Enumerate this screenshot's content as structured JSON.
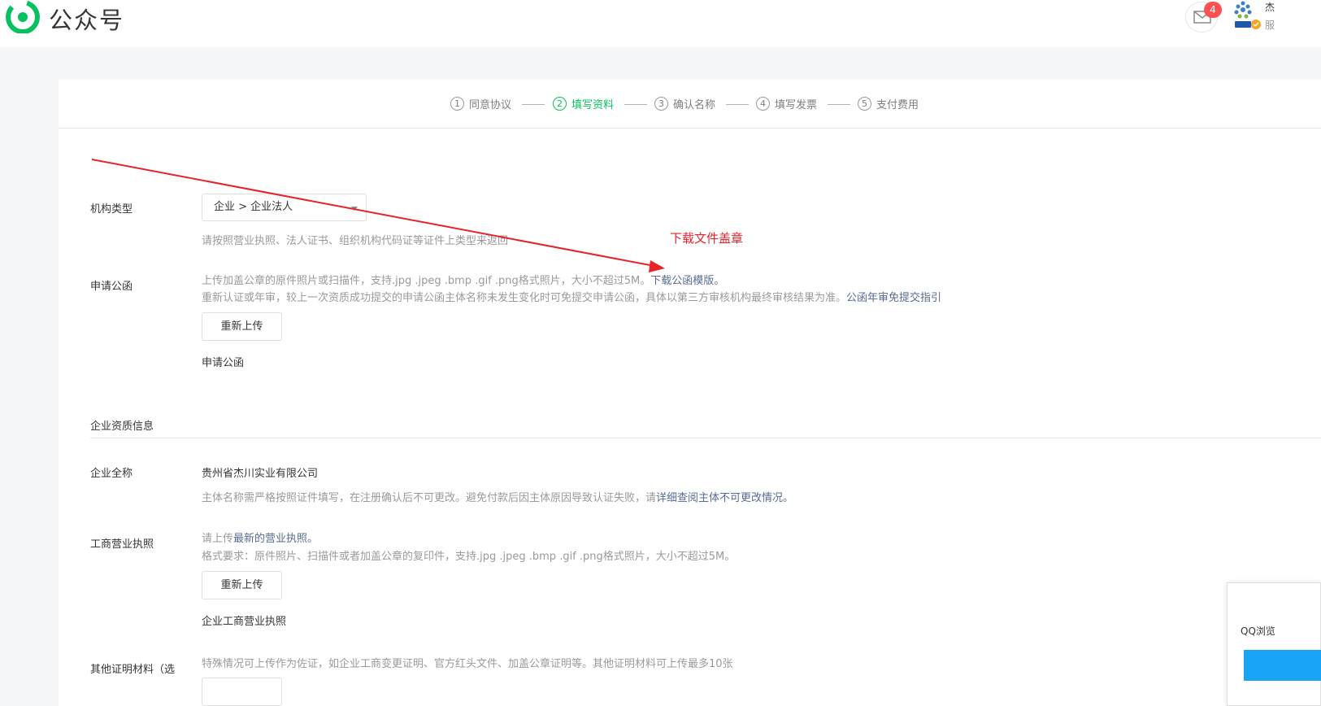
{
  "header": {
    "brand": "公众号",
    "mail_count": "4",
    "user_name": "杰",
    "user_sub": "服"
  },
  "steps": [
    {
      "num": "1",
      "label": "同意协议",
      "active": false
    },
    {
      "num": "2",
      "label": "填写资料",
      "active": true
    },
    {
      "num": "3",
      "label": "确认名称",
      "active": false
    },
    {
      "num": "4",
      "label": "填写发票",
      "active": false
    },
    {
      "num": "5",
      "label": "支付费用",
      "active": false
    }
  ],
  "org_type": {
    "label": "机构类型",
    "value": "企业 > 企业法人",
    "hint": "请按照营业执照、法人证书、组织机构代码证等证件上类型来返回"
  },
  "letter": {
    "label": "申请公函",
    "hint1": "上传加盖公章的原件照片或扫描件，支持.jpg .jpeg .bmp .gif .png格式照片，大小不超过5M。",
    "hint1_link": "下载公函模版。",
    "hint2": "重新认证或年审，较上一次资质成功提交的申请公函主体名称未发生变化时可免提交申请公函，具体以第三方审核机构最终审核结果为准。",
    "hint2_link": "公函年审免提交指引",
    "button": "重新上传",
    "file_name": "申请公函"
  },
  "annotation": {
    "text": "下载文件盖章",
    "color": "#e7222a"
  },
  "qualification": {
    "section_title": "企业资质信息",
    "full_name_label": "企业全称",
    "full_name_value": "贵州省杰川实业有限公司",
    "full_name_hint": "主体名称需严格按照证件填写，在注册确认后不可更改。避免付款后因主体原因导致认证失败，请",
    "full_name_link": "详细查阅主体不可更改情况。",
    "license_label": "工商营业执照",
    "license_hint1_prefix": "请上传",
    "license_hint1_link": "最新的营业执照。",
    "license_hint2": "格式要求：原件照片、扫描件或者加盖公章的复印件，支持.jpg .jpeg .bmp .gif .png格式照片，大小不超过5M。",
    "license_button": "重新上传",
    "license_file": "企业工商营业执照",
    "other_label": "其他证明材料（选",
    "other_hint": "特殊情况可上传作为佐证，如企业工商变更证明、官方红头文件、加盖公章证明等。其他证明材料可上传最多10张"
  },
  "popup": {
    "text": "QQ浏览"
  },
  "colors": {
    "brand_green": "#07c160",
    "link": "#576b95",
    "badge": "#fa5151"
  }
}
